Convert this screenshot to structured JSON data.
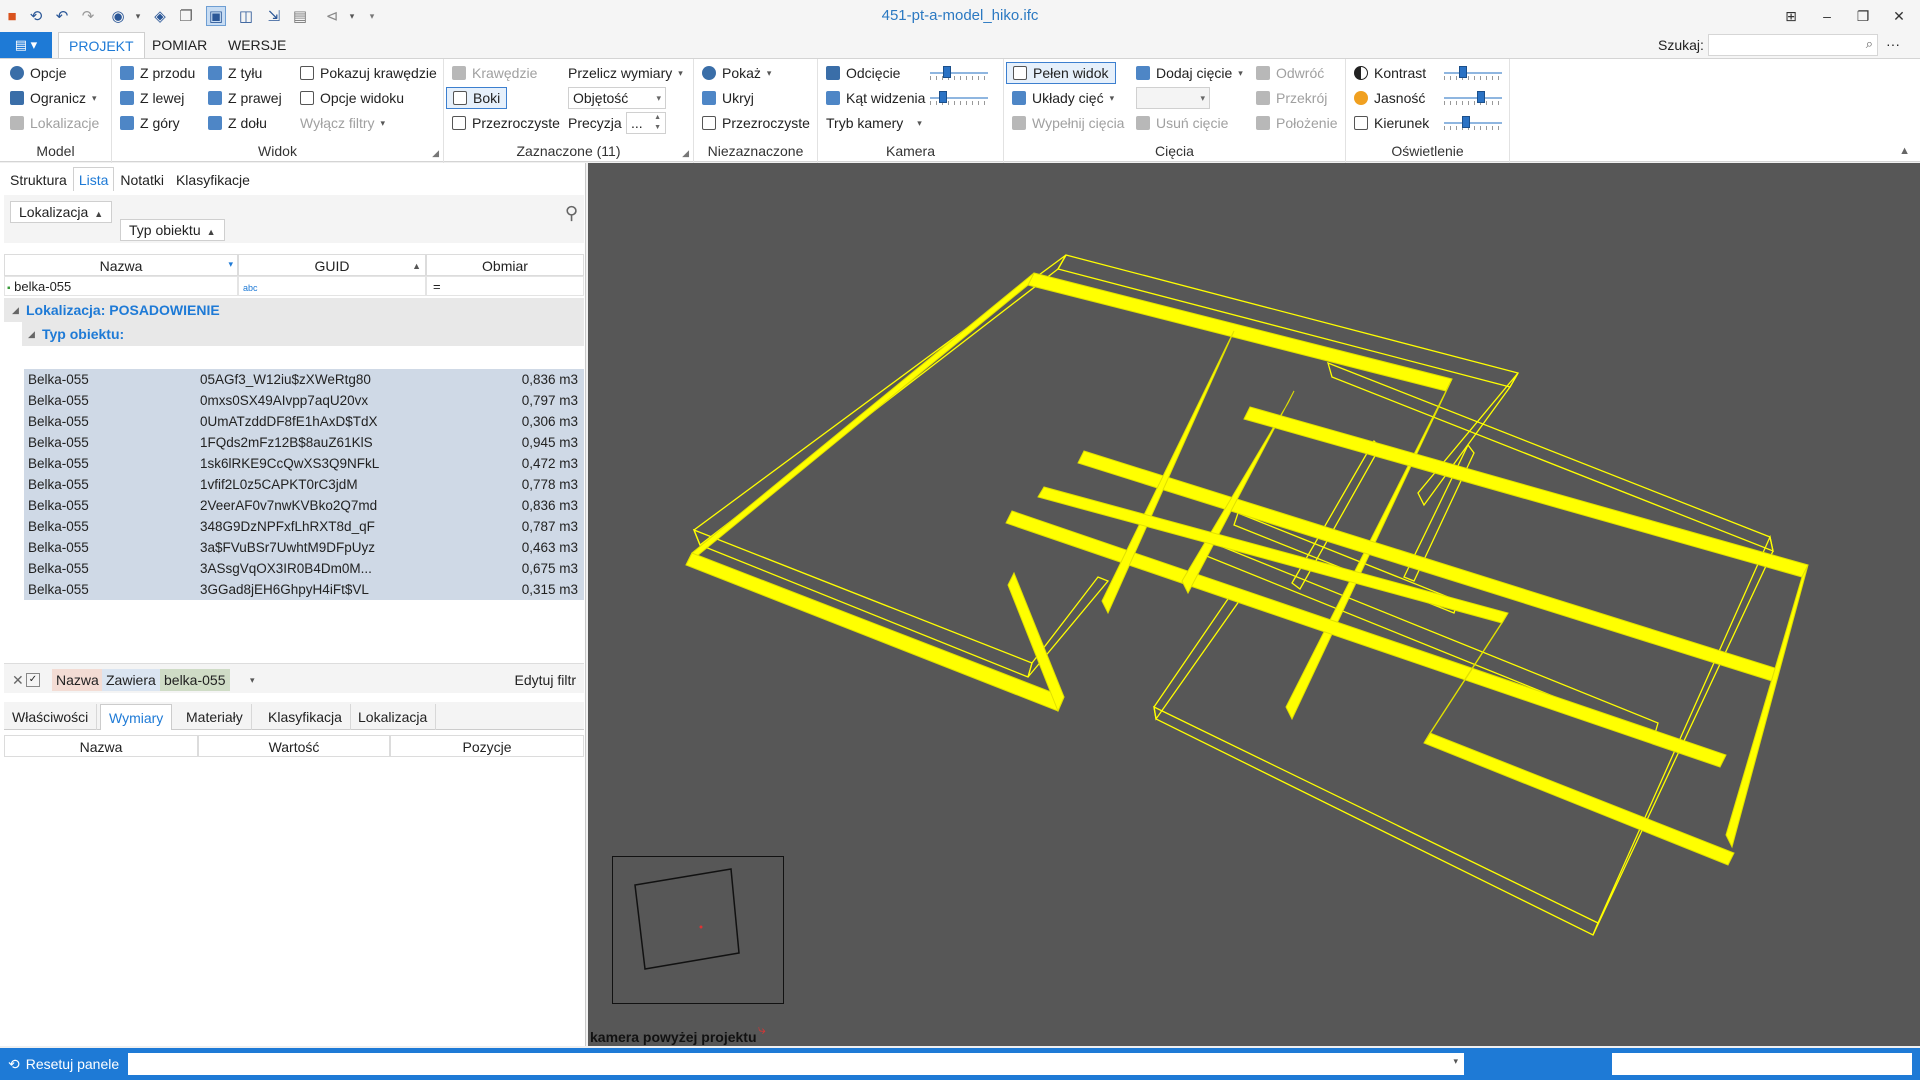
{
  "window": {
    "title": "451-pt-a-model_hiko.ifc"
  },
  "tabs": {
    "file_icon": "menu-icon",
    "items": [
      "PROJEKT",
      "POMIAR",
      "WERSJE"
    ],
    "search_label": "Szukaj:"
  },
  "ribbon": {
    "model": {
      "label": "Model",
      "opcje": "Opcje",
      "ogranicz": "Ogranicz",
      "lokalizacje": "Lokalizacje"
    },
    "widok": {
      "label": "Widok",
      "z_przodu": "Z przodu",
      "z_lewej": "Z lewej",
      "z_gory": "Z góry",
      "z_tylu": "Z tyłu",
      "z_prawej": "Z prawej",
      "z_dolu": "Z dołu",
      "pokazuj_krawedzie": "Pokazuj krawędzie",
      "opcje_widoku": "Opcje widoku",
      "wylacz_filtry": "Wyłącz filtry"
    },
    "zaznaczone": {
      "label": "Zaznaczone (11)",
      "krawedzie": "Krawędzie",
      "boki": "Boki",
      "przezroczyste": "Przezroczyste",
      "przelicz_wymiary": "Przelicz wymiary",
      "objetosc": "Objętość",
      "precyzja": "Precyzja",
      "precyzja_value": "..."
    },
    "niezaznaczone": {
      "label": "Niezaznaczone",
      "pokaz": "Pokaż",
      "ukryj": "Ukryj",
      "przezroczyste": "Przezroczyste"
    },
    "kamera": {
      "label": "Kamera",
      "odciecie": "Odcięcie",
      "kat_widzenia": "Kąt widzenia",
      "tryb_kamery": "Tryb kamery",
      "odciecie_level": 0.25,
      "kat_level": 0.18
    },
    "ciecia": {
      "label": "Cięcia",
      "pelen_widok": "Pełen widok",
      "uklady_ciec": "Układy cięć",
      "wypelnij_ciecia": "Wypełnij cięcia",
      "dodaj_ciecie": "Dodaj cięcie",
      "usun_ciecie": "Usuń cięcie",
      "odwroc": "Odwróć",
      "przekroj": "Przekrój",
      "polozenie": "Położenie"
    },
    "oswietlenie": {
      "label": "Oświetlenie",
      "kontrast": "Kontrast",
      "jasnosc": "Jasność",
      "kierunek": "Kierunek",
      "kontrast_level": 0.3,
      "jasnosc_level": 0.65,
      "kierunek_level": 0.35
    }
  },
  "left_panel": {
    "tabs": [
      "Struktura",
      "Lista",
      "Notatki",
      "Klasyfikacje"
    ],
    "group_chips": [
      "Lokalizacja",
      "Typ obiektu"
    ],
    "columns": [
      "Nazwa",
      "GUID",
      "Obmiar"
    ],
    "filter_row": {
      "name": "belka-055",
      "guid_icon": "abc",
      "obmiar": "="
    },
    "group_location": "Lokalizacja: POSADOWIENIE",
    "group_type": "Typ obiektu:",
    "rows": [
      {
        "name": "Belka-055",
        "guid": "05AGf3_W12iu$zXWeRtg80",
        "value": "0,836 m3"
      },
      {
        "name": "Belka-055",
        "guid": "0mxs0SX49AIvpp7aqU20vx",
        "value": "0,797 m3"
      },
      {
        "name": "Belka-055",
        "guid": "0UmATzddDF8fE1hAxD$TdX",
        "value": "0,306 m3"
      },
      {
        "name": "Belka-055",
        "guid": "1FQds2mFz12B$8auZ61KlS",
        "value": "0,945 m3"
      },
      {
        "name": "Belka-055",
        "guid": "1sk6lRKE9CcQwXS3Q9NFkL",
        "value": "0,472 m3"
      },
      {
        "name": "Belka-055",
        "guid": "1vfif2L0z5CAPKT0rC3jdM",
        "value": "0,778 m3"
      },
      {
        "name": "Belka-055",
        "guid": "2VeerAF0v7nwKVBko2Q7md",
        "value": "0,836 m3"
      },
      {
        "name": "Belka-055",
        "guid": "348G9DzNPFxfLhRXT8d_qF",
        "value": "0,787 m3"
      },
      {
        "name": "Belka-055",
        "guid": "3a$FVuBSr7UwhtM9DFpUyz",
        "value": "0,463 m3"
      },
      {
        "name": "Belka-055",
        "guid": "3ASsgVqOX3IR0B4Dm0M...",
        "value": "0,675 m3"
      },
      {
        "name": "Belka-055",
        "guid": "3GGad8jEH6GhpyH4iFt$VL",
        "value": "0,315 m3"
      }
    ],
    "filter_editor": {
      "field": "Nazwa",
      "operator": "Zawiera",
      "value": "belka-055",
      "edit_label": "Edytuj filtr"
    },
    "bottom_tabs": [
      "Właściwości",
      "Wymiary",
      "Materiały",
      "Klasyfikacja",
      "Lokalizacja"
    ],
    "prop_columns": [
      "Nazwa",
      "Wartość",
      "Pozycje"
    ]
  },
  "viewport": {
    "camera_label": "kamera powyżej projektu",
    "highlight_color": "#ffff00",
    "background_color": "#575757"
  },
  "status": {
    "reset_label": "Resetuj panele"
  }
}
